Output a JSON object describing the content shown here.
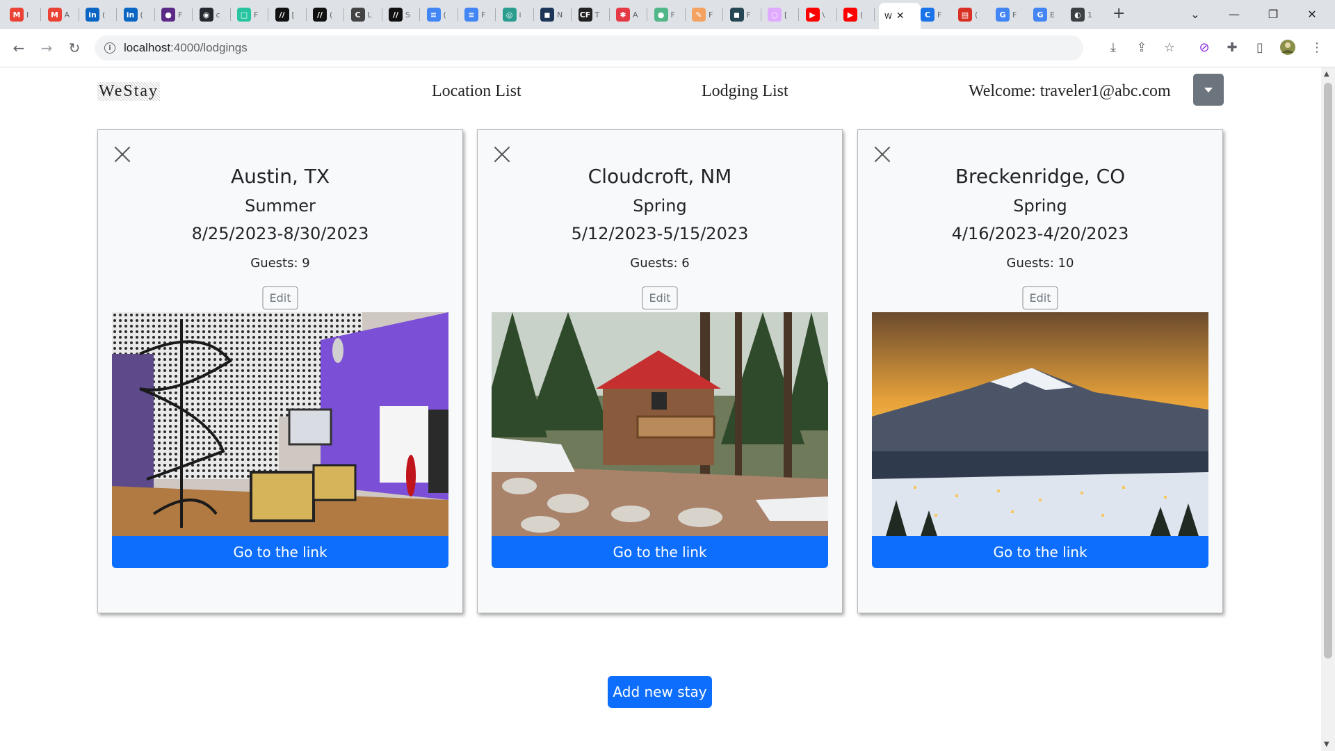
{
  "browser": {
    "tabs": [
      {
        "label": "I",
        "fav": "M",
        "color": "#ea4335"
      },
      {
        "label": "A",
        "fav": "M",
        "color": "#ea4335"
      },
      {
        "label": "(",
        "fav": "in",
        "color": "#0a66c2"
      },
      {
        "label": "(",
        "fav": "in",
        "color": "#0a66c2"
      },
      {
        "label": "F",
        "fav": "●",
        "color": "#5b2a86"
      },
      {
        "label": "c",
        "fav": "◉",
        "color": "#24292f"
      },
      {
        "label": "F",
        "fav": "□",
        "color": "#27c4a0"
      },
      {
        "label": "[",
        "fav": "//",
        "color": "#111111"
      },
      {
        "label": "(",
        "fav": "//",
        "color": "#111111"
      },
      {
        "label": "L",
        "fav": "C",
        "color": "#444444"
      },
      {
        "label": "S",
        "fav": "//",
        "color": "#111111"
      },
      {
        "label": "(",
        "fav": "≡",
        "color": "#4285f4"
      },
      {
        "label": "F",
        "fav": "≡",
        "color": "#4285f4"
      },
      {
        "label": "i",
        "fav": "◎",
        "color": "#2a9d8f"
      },
      {
        "label": "N",
        "fav": "◼",
        "color": "#1d3557"
      },
      {
        "label": "T",
        "fav": "CF",
        "color": "#222222"
      },
      {
        "label": "A",
        "fav": "✱",
        "color": "#e63946"
      },
      {
        "label": "F",
        "fav": "●",
        "color": "#52b788"
      },
      {
        "label": "F",
        "fav": "✎",
        "color": "#f4a261"
      },
      {
        "label": "F",
        "fav": "◼",
        "color": "#264653"
      },
      {
        "label": "[",
        "fav": "○",
        "color": "#e0aaff"
      },
      {
        "label": "\\",
        "fav": "▶",
        "color": "#ff0000"
      },
      {
        "label": "(",
        "fav": "▶",
        "color": "#ff0000"
      }
    ],
    "active_tab": {
      "label": "W",
      "close": "✕"
    },
    "tabs_after": [
      {
        "label": "F",
        "fav": "C",
        "color": "#1a73e8"
      },
      {
        "label": "(",
        "fav": "▤",
        "color": "#d93025"
      },
      {
        "label": "F",
        "fav": "G",
        "color": "#4285f4"
      },
      {
        "label": "E",
        "fav": "G",
        "color": "#4285f4"
      },
      {
        "label": "1",
        "fav": "◐",
        "color": "#3c4043"
      }
    ],
    "new_tab": "+",
    "url_host": "localhost",
    "url_path": ":4000/lodgings"
  },
  "nav": {
    "brand": "WeStay",
    "location_list": "Location List",
    "lodging_list": "Lodging List",
    "welcome": "Welcome: traveler1@abc.com"
  },
  "cards": [
    {
      "city": "Austin, TX",
      "season": "Summer",
      "dates": "8/25/2023-8/30/2023",
      "guests": "Guests: 9",
      "edit": "Edit",
      "link": "Go to the link"
    },
    {
      "city": "Cloudcroft, NM",
      "season": "Spring",
      "dates": "5/12/2023-5/15/2023",
      "guests": "Guests: 6",
      "edit": "Edit",
      "link": "Go to the link"
    },
    {
      "city": "Breckenridge, CO",
      "season": "Spring",
      "dates": "4/16/2023-4/20/2023",
      "guests": "Guests: 10",
      "edit": "Edit",
      "link": "Go to the link"
    }
  ],
  "add_stay": "Add new stay",
  "colors": {
    "primary": "#0d6efd",
    "secondary": "#6c757d"
  }
}
